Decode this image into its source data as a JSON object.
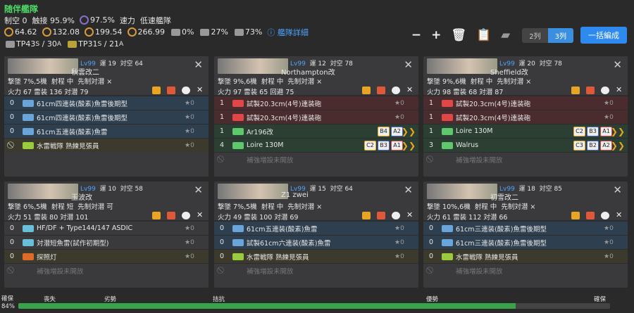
{
  "fleet": {
    "title": "随伴艦隊",
    "air": "制空 0",
    "contact": "触接 95.9%",
    "star_pct": "97.5%",
    "speed_label": "速力",
    "speed": "低速艦隊",
    "los": [
      "64.62",
      "132.08",
      "199.54",
      "266.99"
    ],
    "g1": "0%",
    "g2": "27%",
    "g3": "73%",
    "detail": "艦隊詳細",
    "tp1_a": "43",
    "tp1_b": "30",
    "tp2_a": "31",
    "tp2_b": "21",
    "sub_s": "S",
    "sub_a": "A",
    "tp_label": "TP"
  },
  "toolbar": {
    "minus": "−",
    "plus": "+",
    "col2": "2列",
    "col3": "3列",
    "bulk": "一括編成"
  },
  "ships": [
    {
      "lv": "Lv99",
      "luck": "運 19",
      "aa": "対空 64",
      "name": "秋雲改二",
      "bomb": "撃墜 7%,5機",
      "range": "射程 中",
      "asw": "先制対潜 ×",
      "fp": "火力 67",
      "torp": "雷装 136",
      "extra": "対潜 79",
      "eq": [
        {
          "n": "0",
          "nm": "61cm四連装(酸素)魚雷後期型",
          "s": "★0",
          "c": "e-t",
          "ic": "#6aa4d8"
        },
        {
          "n": "0",
          "nm": "61cm四連装(酸素)魚雷後期型",
          "s": "★0",
          "c": "e-t",
          "ic": "#6aa4d8"
        },
        {
          "n": "0",
          "nm": "61cm五連装(酸素)魚雷",
          "s": "★0",
          "c": "e-t",
          "ic": "#6aa4d8"
        },
        {
          "n": "⃠",
          "nm": "水雷戦隊 熟練見張員",
          "s": "★0",
          "c": "e-g",
          "ic": "#9acb3e"
        }
      ]
    },
    {
      "lv": "Lv99",
      "luck": "運 12",
      "aa": "対空 78",
      "name": "Northampton改",
      "bomb": "撃墜 9%,6機",
      "range": "射程 中",
      "asw": "先制対潜 ×",
      "fp": "火力 97",
      "torp": "雷装 65",
      "extra": "回避 75",
      "eq": [
        {
          "n": "1",
          "nm": "試製20.3cm(4号)連装砲",
          "s": "★0",
          "c": "e-r",
          "ic": "#e04848"
        },
        {
          "n": "1",
          "nm": "試製20.3cm(4号)連装砲",
          "s": "★0",
          "c": "e-r",
          "ic": "#e04848"
        },
        {
          "n": "1",
          "nm": "Ar196改",
          "s": "",
          "c": "e-p",
          "ic": "#5fc86d",
          "pf": [
            "B4",
            "A2"
          ],
          "ch": "❯❯"
        },
        {
          "n": "4",
          "nm": "Loire 130M",
          "s": "",
          "c": "e-p",
          "ic": "#5fc86d",
          "pf": [
            "C2",
            "B3",
            "A1"
          ],
          "ch": "❯❯"
        },
        {
          "n": "⃠",
          "nm": "補強増設未開放",
          "s": "",
          "c": "e-e",
          "ic": ""
        }
      ]
    },
    {
      "lv": "Lv99",
      "luck": "運 20",
      "aa": "対空 78",
      "name": "Sheffield改",
      "bomb": "撃墜 9%,6機",
      "range": "射程 中",
      "asw": "先制対潜 ×",
      "fp": "火力 98",
      "torp": "雷装 68",
      "extra": "対潜 87",
      "eq": [
        {
          "n": "1",
          "nm": "試製20.3cm(4号)連装砲",
          "s": "★0",
          "c": "e-r",
          "ic": "#e04848"
        },
        {
          "n": "1",
          "nm": "試製20.3cm(4号)連装砲",
          "s": "★0",
          "c": "e-r",
          "ic": "#e04848"
        },
        {
          "n": "1",
          "nm": "Loire 130M",
          "s": "",
          "c": "e-p",
          "ic": "#5fc86d",
          "pf": [
            "C2",
            "B3",
            "A1"
          ],
          "ch": "❯❯"
        },
        {
          "n": "3",
          "nm": "Walrus",
          "s": "",
          "c": "e-p",
          "ic": "#5fc86d",
          "pf": [
            "C3",
            "B2",
            "A2"
          ],
          "ch": "❯❯"
        },
        {
          "n": "⃠",
          "nm": "補強増設未開放",
          "s": "",
          "c": "e-e",
          "ic": ""
        }
      ]
    },
    {
      "lv": "Lv99",
      "luck": "運 10",
      "aa": "対空 58",
      "name": "玉波改",
      "bomb": "撃墜 6%,5機",
      "range": "射程 短",
      "asw": "先制対潜 可",
      "fp": "火力 51",
      "torp": "雷装 80",
      "extra": "対潜 101",
      "eq": [
        {
          "n": "0",
          "nm": "HF/DF + Type144/147 ASDIC",
          "s": "★0",
          "c": "",
          "ic": "#6abfd8"
        },
        {
          "n": "0",
          "nm": "対潜短魚雷(試作初期型)",
          "s": "★0",
          "c": "",
          "ic": "#6abfd8"
        },
        {
          "n": "0",
          "nm": "探照灯",
          "s": "★0",
          "c": "e-g",
          "ic": "#e06a2a"
        },
        {
          "n": "⃠",
          "nm": "補強増設未開放",
          "s": "",
          "c": "e-e",
          "ic": ""
        }
      ]
    },
    {
      "lv": "Lv99",
      "luck": "運 15",
      "aa": "対空 64",
      "name": "Z1 zwei",
      "bomb": "撃墜 7%,5機",
      "range": "射程 中",
      "asw": "先制対潜 ×",
      "fp": "火力 49",
      "torp": "雷装 100",
      "extra": "対潜 69",
      "eq": [
        {
          "n": "0",
          "nm": "61cm五連装(酸素)魚雷",
          "s": "★0",
          "c": "e-t",
          "ic": "#6aa4d8"
        },
        {
          "n": "0",
          "nm": "試製61cm六連装(酸素)魚雷",
          "s": "★0",
          "c": "e-t",
          "ic": "#6aa4d8"
        },
        {
          "n": "0",
          "nm": "水雷戦隊 熟練見張員",
          "s": "★0",
          "c": "e-g",
          "ic": "#9acb3e"
        },
        {
          "n": "⃠",
          "nm": "補強増設未開放",
          "s": "",
          "c": "e-e",
          "ic": ""
        }
      ]
    },
    {
      "lv": "Lv99",
      "luck": "運 18",
      "aa": "対空 85",
      "name": "初雪改二",
      "bomb": "撃墜 10%,6機",
      "range": "射程 中",
      "asw": "先制対潜 ×",
      "fp": "火力 61",
      "torp": "雷装 112",
      "extra": "対潜 66",
      "eq": [
        {
          "n": "0",
          "nm": "61cm三連装(酸素)魚雷後期型",
          "s": "★0",
          "c": "e-t",
          "ic": "#6aa4d8"
        },
        {
          "n": "0",
          "nm": "61cm三連装(酸素)魚雷後期型",
          "s": "★0",
          "c": "e-t",
          "ic": "#6aa4d8"
        },
        {
          "n": "0",
          "nm": "水雷戦隊 熟練見張員",
          "s": "★0",
          "c": "e-g",
          "ic": "#9acb3e"
        },
        {
          "n": "⃠",
          "nm": "補強増設未開放",
          "s": "",
          "c": "e-e",
          "ic": ""
        }
      ]
    }
  ],
  "footer": {
    "left": "確保",
    "right": "確保",
    "pct": "84%",
    "labels": [
      "喪失",
      "劣勢",
      "拮抗",
      "優勢"
    ],
    "fill": 0.84
  }
}
